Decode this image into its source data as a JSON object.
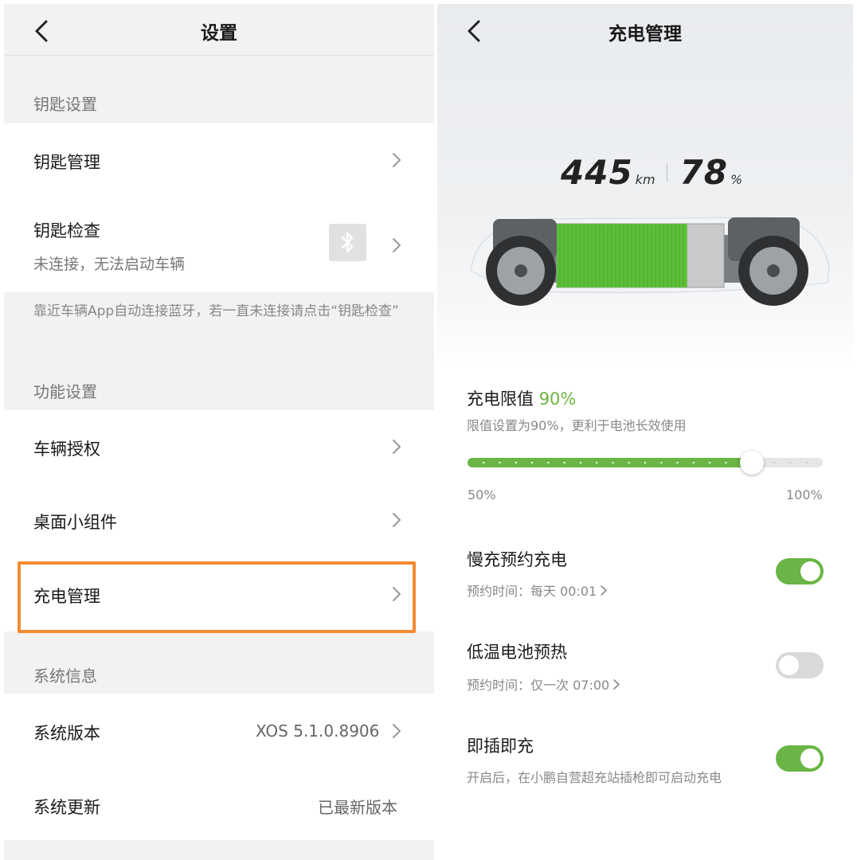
{
  "left": {
    "title": "设置",
    "sections": {
      "key": "钥匙设置",
      "function": "功能设置",
      "system": "系统信息"
    },
    "items": {
      "key_manage": "钥匙管理",
      "key_check": "钥匙检查",
      "key_check_status": "未连接，无法启动车辆",
      "key_hint": "靠近车辆App自动连接蓝牙，若一直未连接请点击“钥匙检查”",
      "vehicle_auth": "车辆授权",
      "desktop_widget": "桌面小组件",
      "charge_manage": "充电管理",
      "system_version": "系统版本",
      "system_version_value": "XOS 5.1.0.8906",
      "system_update": "系统更新",
      "system_update_value": "已最新版本"
    },
    "highlight_color": "#f28b32"
  },
  "right": {
    "title": "充电管理",
    "range_value": "445",
    "range_unit": "km",
    "battery_value": "78",
    "battery_unit": "%",
    "battery_level": 0.78,
    "charge_limit": {
      "label": "充电限值",
      "value": "90%",
      "desc": "限值设置为90%，更利于电池长效使用",
      "min_label": "50%",
      "max_label": "100%",
      "min": 50,
      "max": 100,
      "current": 90
    },
    "slow_charge": {
      "label": "慢充预约充电",
      "schedule": "预约时间：每天 00:01",
      "enabled": true
    },
    "preheat": {
      "label": "低温电池预热",
      "schedule": "预约时间：仅一次 07:00",
      "enabled": false
    },
    "plug_charge": {
      "label": "即插即充",
      "desc": "开启后，在小鹏自营超充站插枪即可启动充电",
      "enabled": true
    },
    "accent_color": "#6ab545"
  }
}
